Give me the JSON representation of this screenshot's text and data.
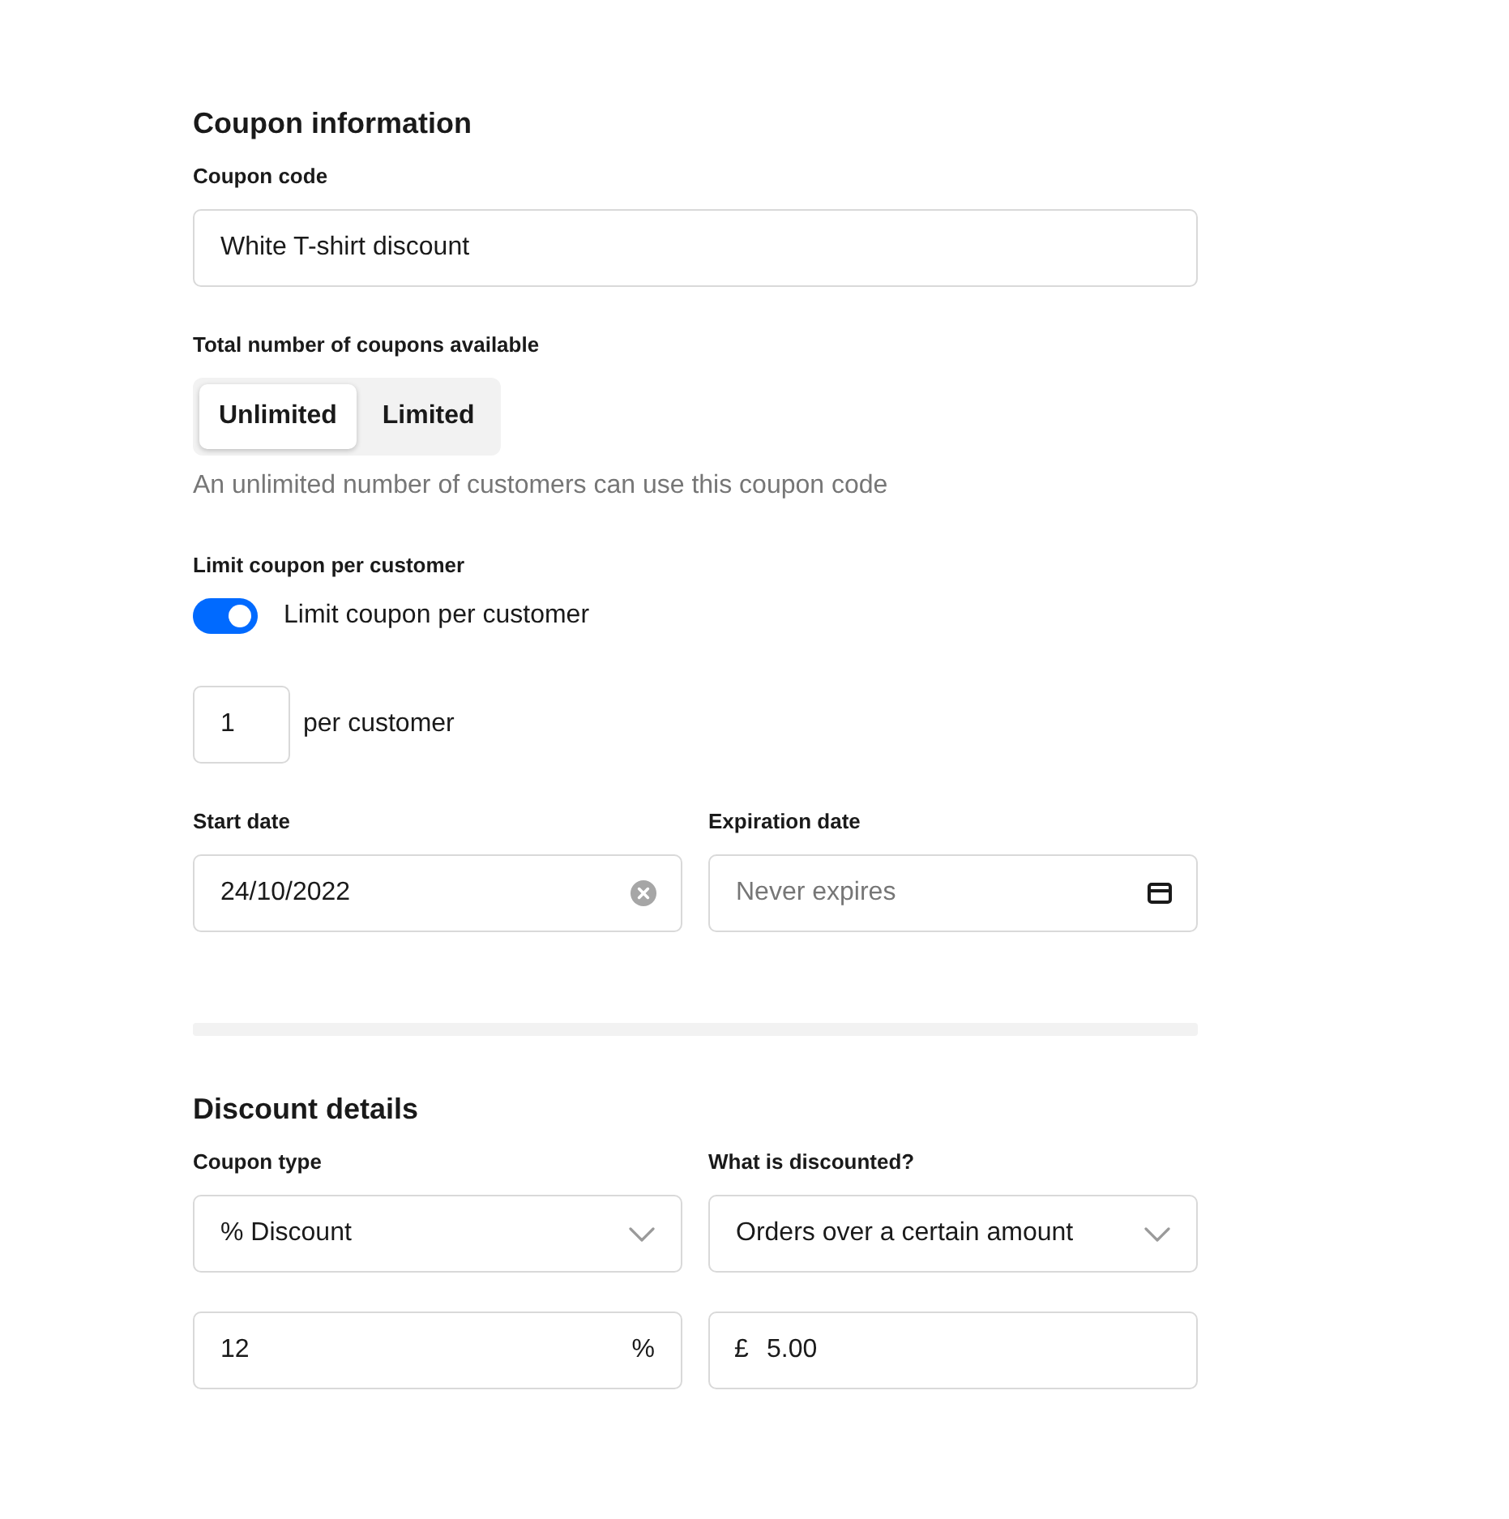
{
  "coupon_information": {
    "title": "Coupon information",
    "coupon_code": {
      "label": "Coupon code",
      "value": "White T-shirt discount"
    },
    "total_coupons": {
      "label": "Total number of coupons available",
      "options": [
        {
          "label": "Unlimited",
          "selected": true
        },
        {
          "label": "Limited",
          "selected": false
        }
      ],
      "helper": "An unlimited number of customers can use this coupon code"
    },
    "limit_per_customer": {
      "label": "Limit coupon per customer",
      "toggle": {
        "label": "Limit coupon per customer",
        "on": true
      },
      "quantity": {
        "value": "1",
        "suffix": "per customer"
      }
    },
    "start_date": {
      "label": "Start date",
      "value": "24/10/2022"
    },
    "expiration_date": {
      "label": "Expiration date",
      "placeholder": "Never expires"
    }
  },
  "discount_details": {
    "title": "Discount details",
    "coupon_type": {
      "label": "Coupon type",
      "value": "% Discount"
    },
    "what_is_discounted": {
      "label": "What is discounted?",
      "value": "Orders over a certain amount"
    },
    "percentage": {
      "value": "12",
      "suffix": "%"
    },
    "minimum_amount": {
      "prefix": "£",
      "value": "5.00"
    }
  }
}
